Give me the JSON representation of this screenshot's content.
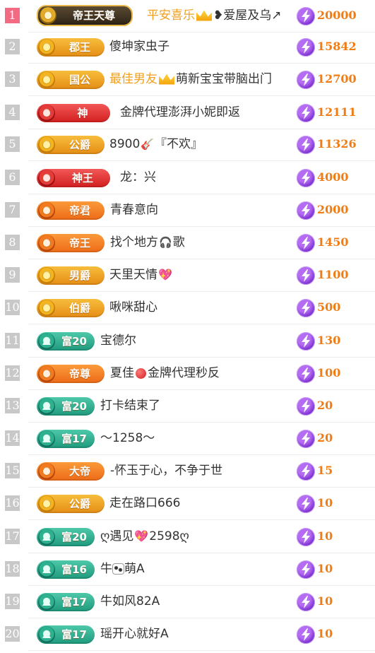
{
  "rows": [
    {
      "rank": "1",
      "badge": "帝王天尊",
      "badge_style": "dark",
      "name_parts": [
        {
          "t": "平安喜乐",
          "gold": true
        },
        {
          "icon": "crown"
        },
        {
          "t": "❥爱屋及乌↗"
        }
      ],
      "value": "20000"
    },
    {
      "rank": "2",
      "badge": "郡王",
      "badge_style": "gold",
      "name_parts": [
        {
          "t": "傻坤家虫子"
        }
      ],
      "value": "15842"
    },
    {
      "rank": "3",
      "badge": "国公",
      "badge_style": "gold",
      "name_parts": [
        {
          "t": "最佳男友",
          "gold": true
        },
        {
          "icon": "crown"
        },
        {
          "t": "萌新宝宝带脑出门"
        }
      ],
      "value": "12700"
    },
    {
      "rank": "4",
      "badge": "神",
      "badge_style": "red",
      "name_parts": [
        {
          "t": "金牌代理澎湃小妮即返"
        }
      ],
      "value": "12111"
    },
    {
      "rank": "5",
      "badge": "公爵",
      "badge_style": "gold",
      "name_parts": [
        {
          "t": "8900"
        },
        {
          "icon": "guitar"
        },
        {
          "t": "『不欢』"
        }
      ],
      "value": "11326"
    },
    {
      "rank": "6",
      "badge": "神王",
      "badge_style": "red",
      "name_parts": [
        {
          "t": "龙：兴"
        }
      ],
      "value": "4000"
    },
    {
      "rank": "7",
      "badge": "帝君",
      "badge_style": "orange",
      "name_parts": [
        {
          "t": "青春意向"
        }
      ],
      "value": "2000"
    },
    {
      "rank": "8",
      "badge": "帝王",
      "badge_style": "orange",
      "name_parts": [
        {
          "t": "找个地方"
        },
        {
          "icon": "headphones"
        },
        {
          "t": "歌"
        }
      ],
      "value": "1450"
    },
    {
      "rank": "9",
      "badge": "男爵",
      "badge_style": "gold",
      "name_parts": [
        {
          "t": "天里天情"
        },
        {
          "icon": "heart"
        }
      ],
      "value": "1100"
    },
    {
      "rank": "10",
      "badge": "伯爵",
      "badge_style": "gold",
      "name_parts": [
        {
          "t": "啾咪甜心"
        }
      ],
      "value": "500"
    },
    {
      "rank": "11",
      "badge": "富20",
      "badge_style": "teal",
      "name_parts": [
        {
          "t": "宝德尔"
        }
      ],
      "value": "130"
    },
    {
      "rank": "12",
      "badge": "帝尊",
      "badge_style": "orange",
      "name_parts": [
        {
          "t": "夏佳"
        },
        {
          "icon": "apple"
        },
        {
          "t": "金牌代理秒反"
        }
      ],
      "value": "100"
    },
    {
      "rank": "13",
      "badge": "富20",
      "badge_style": "teal",
      "name_parts": [
        {
          "t": "打卡结束了"
        }
      ],
      "value": "20"
    },
    {
      "rank": "14",
      "badge": "富17",
      "badge_style": "teal",
      "name_parts": [
        {
          "t": "～1258～"
        }
      ],
      "value": "20"
    },
    {
      "rank": "15",
      "badge": "大帝",
      "badge_style": "orange",
      "name_parts": [
        {
          "t": "-怀玉于心，不争于世"
        }
      ],
      "value": "15"
    },
    {
      "rank": "16",
      "badge": "公爵",
      "badge_style": "gold",
      "name_parts": [
        {
          "t": "走在路口666"
        }
      ],
      "value": "10"
    },
    {
      "rank": "17",
      "badge": "富20",
      "badge_style": "teal",
      "name_parts": [
        {
          "t": "ღ遇见"
        },
        {
          "icon": "heart"
        },
        {
          "t": "2598ღ"
        }
      ],
      "value": "10"
    },
    {
      "rank": "18",
      "badge": "富16",
      "badge_style": "teal",
      "name_parts": [
        {
          "t": "牛"
        },
        {
          "icon": "cow"
        },
        {
          "t": "萌A"
        }
      ],
      "value": "10"
    },
    {
      "rank": "19",
      "badge": "富17",
      "badge_style": "teal",
      "name_parts": [
        {
          "t": "牛如风82A"
        }
      ],
      "value": "10"
    },
    {
      "rank": "20",
      "badge": "富17",
      "badge_style": "teal",
      "name_parts": [
        {
          "t": "瑶开心就好A"
        }
      ],
      "value": "10"
    }
  ],
  "colors": {
    "value": "#f07c14",
    "gold_name": "#f0a020",
    "rank1": "#f26b82",
    "rank": "#c8c8c8"
  },
  "icons": {
    "currency": "lightning-gem-icon"
  }
}
